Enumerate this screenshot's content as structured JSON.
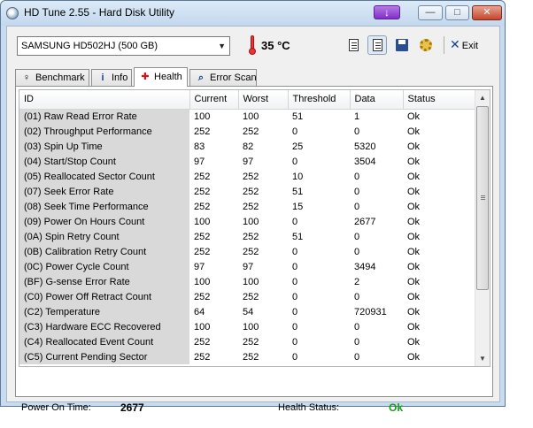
{
  "window": {
    "title": "HD Tune 2.55 - Hard Disk Utility",
    "extra_button_glyph": "↓",
    "minimize_glyph": "—",
    "maximize_glyph": "□",
    "close_glyph": "✕"
  },
  "toolbar": {
    "drive": "SAMSUNG HD502HJ (500 GB)",
    "temperature": "35 °C",
    "icons": [
      "copy-icon",
      "copy-text-icon",
      "save-icon",
      "options-icon"
    ],
    "exit_label": "Exit"
  },
  "tabs": [
    {
      "label": "Benchmark",
      "icon": "benchmark-icon",
      "active": false
    },
    {
      "label": "Info",
      "icon": "info-icon",
      "active": false
    },
    {
      "label": "Health",
      "icon": "health-cross-icon",
      "active": true
    },
    {
      "label": "Error Scan",
      "icon": "magnifier-icon",
      "active": false
    }
  ],
  "table": {
    "headers": [
      "ID",
      "Current",
      "Worst",
      "Threshold",
      "Data",
      "Status"
    ],
    "rows": [
      [
        "(01) Raw Read Error Rate",
        "100",
        "100",
        "51",
        "1",
        "Ok"
      ],
      [
        "(02) Throughput Performance",
        "252",
        "252",
        "0",
        "0",
        "Ok"
      ],
      [
        "(03) Spin Up Time",
        "83",
        "82",
        "25",
        "5320",
        "Ok"
      ],
      [
        "(04) Start/Stop Count",
        "97",
        "97",
        "0",
        "3504",
        "Ok"
      ],
      [
        "(05) Reallocated Sector Count",
        "252",
        "252",
        "10",
        "0",
        "Ok"
      ],
      [
        "(07) Seek Error Rate",
        "252",
        "252",
        "51",
        "0",
        "Ok"
      ],
      [
        "(08) Seek Time Performance",
        "252",
        "252",
        "15",
        "0",
        "Ok"
      ],
      [
        "(09) Power On Hours Count",
        "100",
        "100",
        "0",
        "2677",
        "Ok"
      ],
      [
        "(0A) Spin Retry Count",
        "252",
        "252",
        "51",
        "0",
        "Ok"
      ],
      [
        "(0B) Calibration Retry Count",
        "252",
        "252",
        "0",
        "0",
        "Ok"
      ],
      [
        "(0C) Power Cycle Count",
        "97",
        "97",
        "0",
        "3494",
        "Ok"
      ],
      [
        "(BF) G-sense Error Rate",
        "100",
        "100",
        "0",
        "2",
        "Ok"
      ],
      [
        "(C0) Power Off Retract Count",
        "252",
        "252",
        "0",
        "0",
        "Ok"
      ],
      [
        "(C2) Temperature",
        "64",
        "54",
        "0",
        "720931",
        "Ok"
      ],
      [
        "(C3) Hardware ECC Recovered",
        "100",
        "100",
        "0",
        "0",
        "Ok"
      ],
      [
        "(C4) Reallocated Event Count",
        "252",
        "252",
        "0",
        "0",
        "Ok"
      ],
      [
        "(C5) Current Pending Sector",
        "252",
        "252",
        "0",
        "0",
        "Ok"
      ]
    ]
  },
  "footer": {
    "power_on_time_label": "Power On Time:",
    "power_on_time_value": "2677",
    "health_status_label": "Health Status:",
    "health_status_value": "Ok"
  },
  "colors": {
    "ok_green": "#19a019",
    "id_column_bg": "#d9d9d9"
  }
}
